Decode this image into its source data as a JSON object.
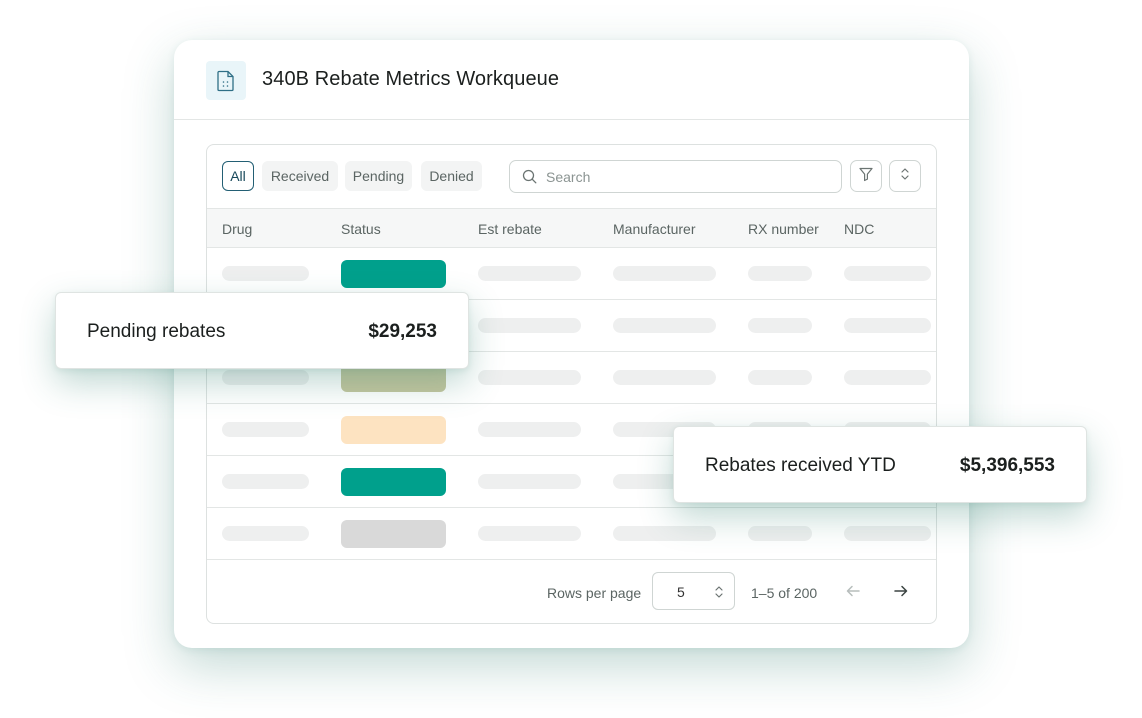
{
  "window": {
    "title": "340B Rebate Metrics Workqueue",
    "icon": "document-icon"
  },
  "filters": {
    "chips": [
      "All",
      "Received",
      "Pending",
      "Denied"
    ],
    "active": "All"
  },
  "search": {
    "placeholder": "Search",
    "value": ""
  },
  "table": {
    "columns": [
      "Drug",
      "Status",
      "Est rebate",
      "Manufacturer",
      "RX number",
      "NDC"
    ],
    "row_status_colors": [
      "#00a08c",
      "#00a08c",
      "#c5c69f",
      "#fde3c1",
      "#00a08c",
      "#d9d9d9"
    ]
  },
  "pagination": {
    "rows_per_page_label": "Rows per page",
    "rows_per_page": "5",
    "range": "1–5 of 200"
  },
  "cards": {
    "pending": {
      "label": "Pending rebates",
      "value": "$29,253"
    },
    "received": {
      "label": "Rebates received YTD",
      "value": "$5,396,553"
    }
  },
  "colors": {
    "accent": "#00a08c",
    "active_chip_border": "#235f74",
    "shadow_tint": "#2d7d6e"
  }
}
